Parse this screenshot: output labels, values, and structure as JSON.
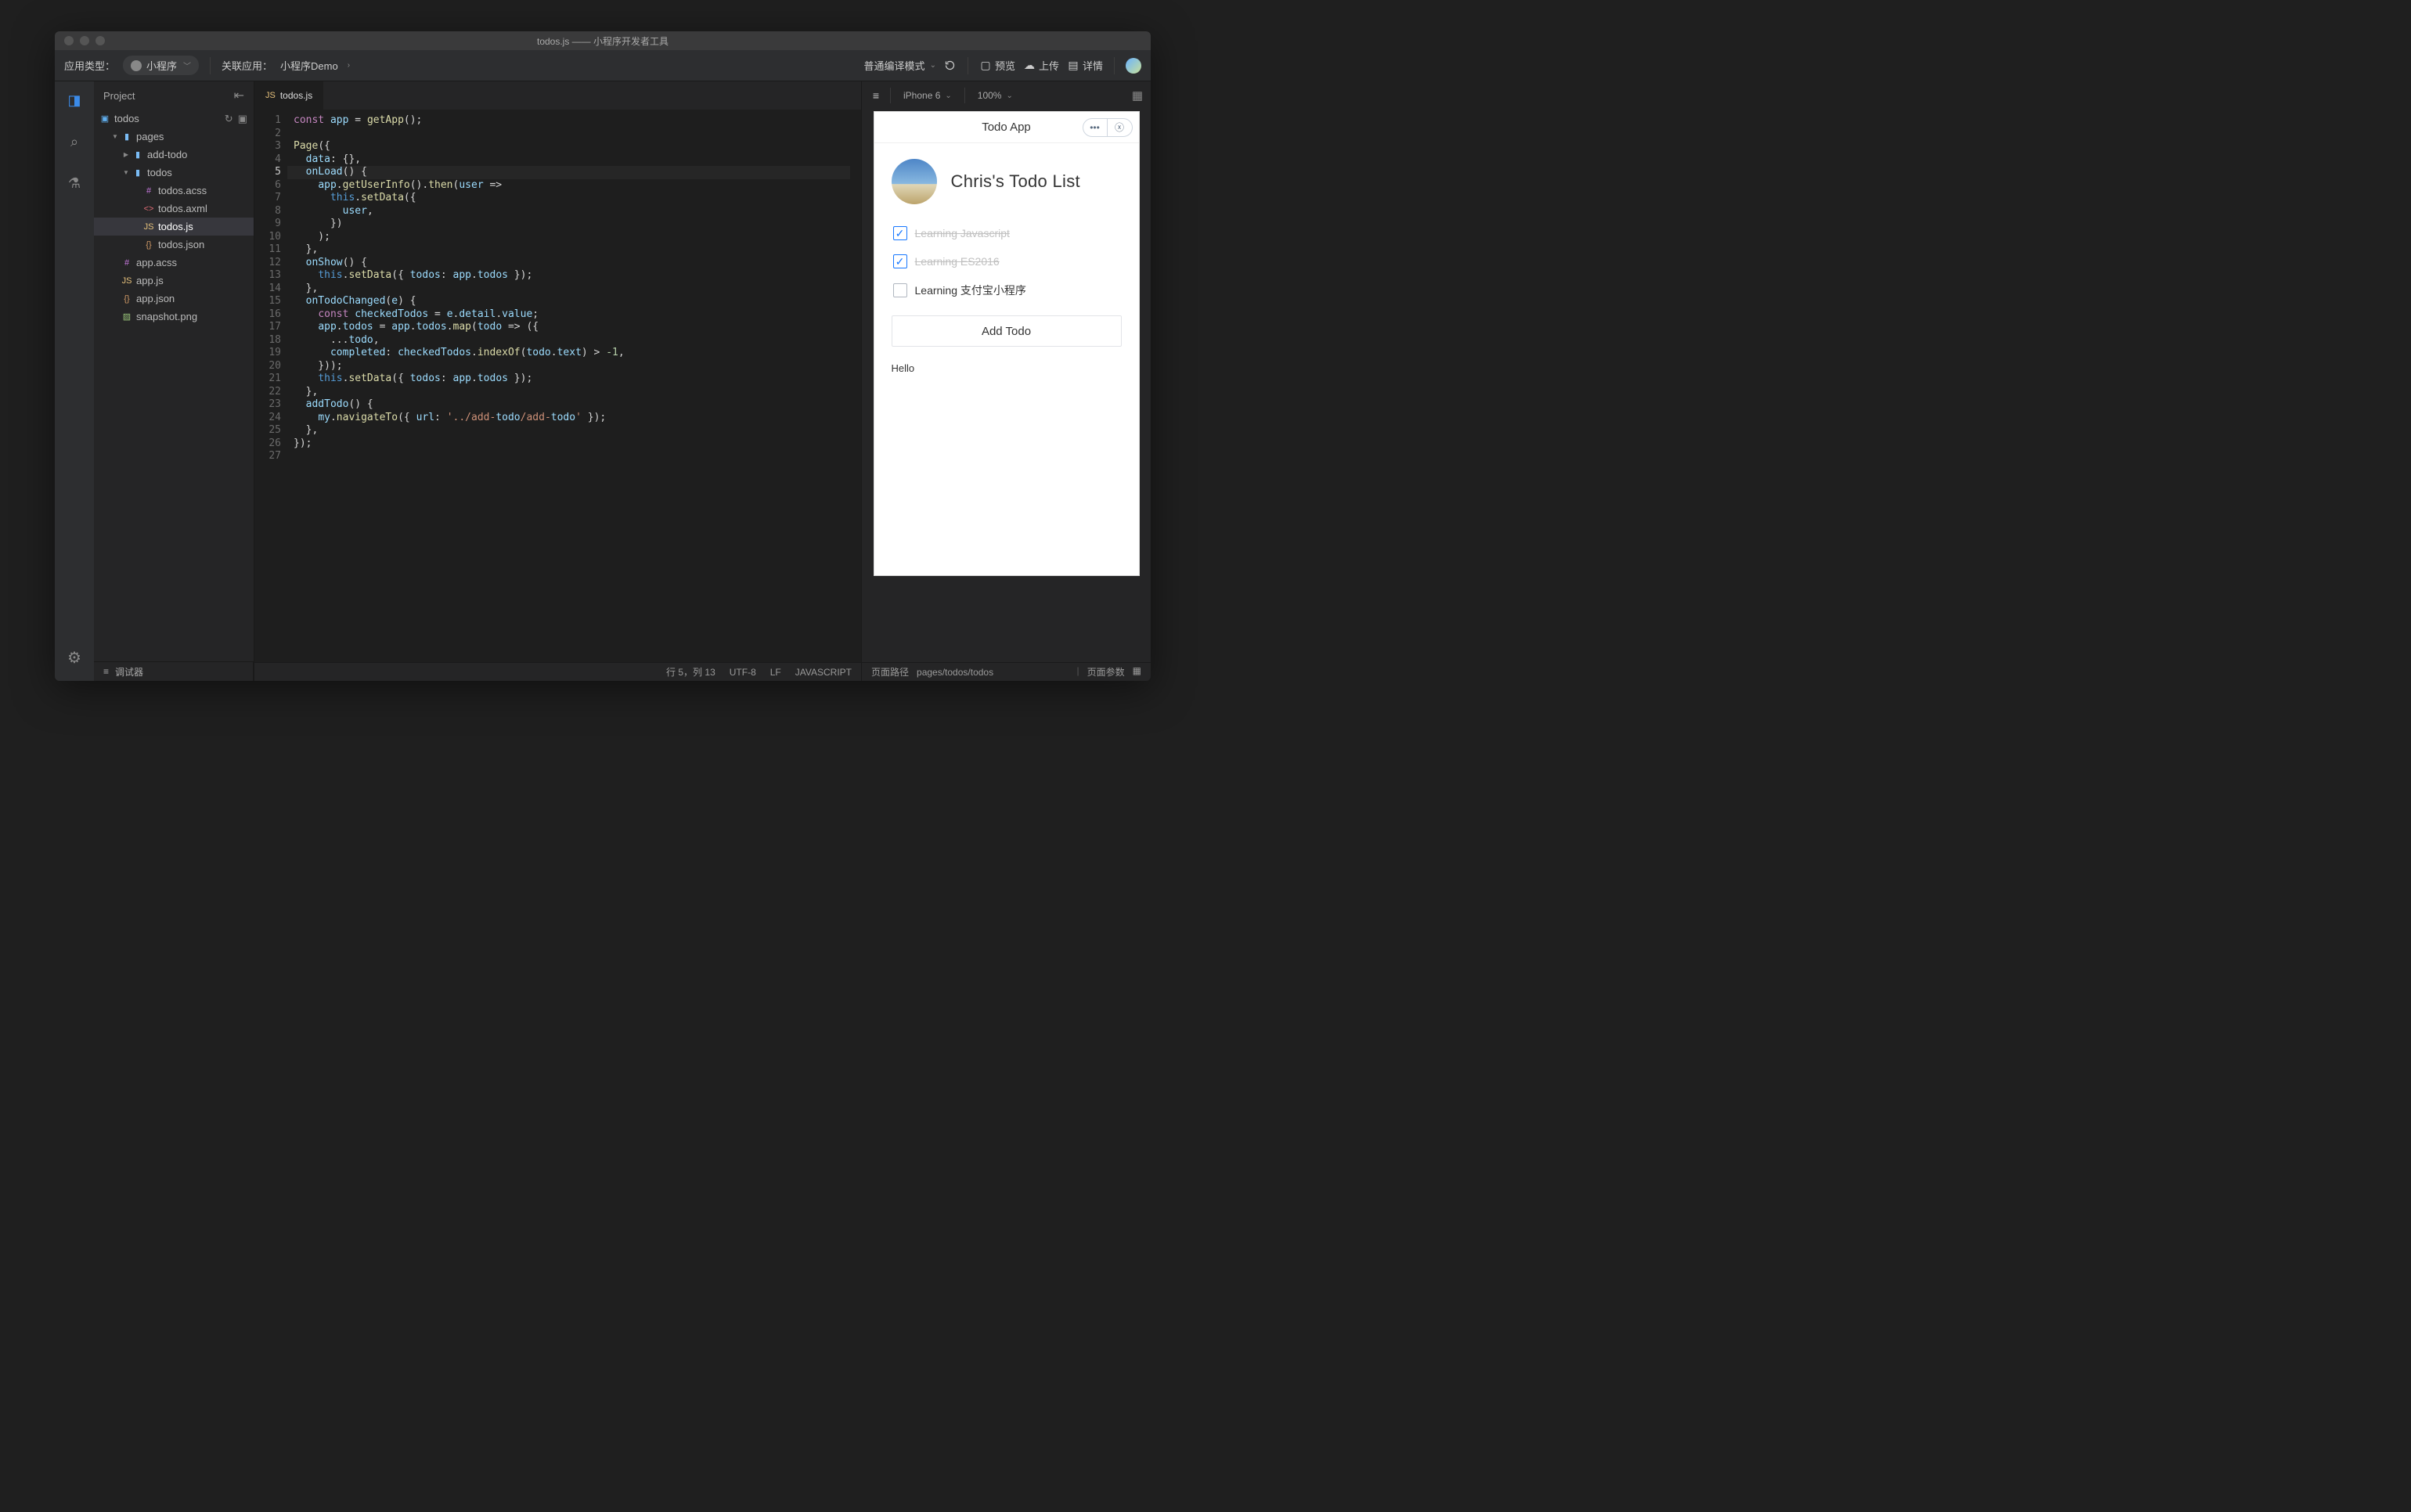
{
  "window": {
    "title": "todos.js —— 小程序开发者工具"
  },
  "menubar": {
    "app_type_label": "应用类型：",
    "app_type_value": "小程序",
    "assoc_label": "关联应用：",
    "assoc_value": "小程序Demo",
    "compile_mode": "普通编译模式",
    "preview": "预览",
    "upload": "上传",
    "details": "详情"
  },
  "explorer": {
    "header": "Project",
    "root": "todos",
    "items": [
      {
        "type": "folder",
        "name": "pages",
        "expanded": true,
        "depth": 1
      },
      {
        "type": "folder",
        "name": "add-todo",
        "expanded": false,
        "depth": 2
      },
      {
        "type": "folder",
        "name": "todos",
        "expanded": true,
        "depth": 2
      },
      {
        "type": "file",
        "name": "todos.acss",
        "icon": "hash",
        "depth": 3
      },
      {
        "type": "file",
        "name": "todos.axml",
        "icon": "xml",
        "depth": 3
      },
      {
        "type": "file",
        "name": "todos.js",
        "icon": "js",
        "depth": 3,
        "selected": true
      },
      {
        "type": "file",
        "name": "todos.json",
        "icon": "json",
        "depth": 3
      },
      {
        "type": "file",
        "name": "app.acss",
        "icon": "hash",
        "depth": 1
      },
      {
        "type": "file",
        "name": "app.js",
        "icon": "js",
        "depth": 1
      },
      {
        "type": "file",
        "name": "app.json",
        "icon": "json",
        "depth": 1
      },
      {
        "type": "file",
        "name": "snapshot.png",
        "icon": "img",
        "depth": 1
      }
    ]
  },
  "editor": {
    "tab_label": "todos.js",
    "lines": [
      "const app = getApp();",
      "",
      "Page({",
      "  data: {},",
      "  onLoad() {",
      "    app.getUserInfo().then(user =>",
      "      this.setData({",
      "        user,",
      "      })",
      "    );",
      "  },",
      "  onShow() {",
      "    this.setData({ todos: app.todos });",
      "  },",
      "  onTodoChanged(e) {",
      "    const checkedTodos = e.detail.value;",
      "    app.todos = app.todos.map(todo => ({",
      "      ...todo,",
      "      completed: checkedTodos.indexOf(todo.text) > -1,",
      "    }));",
      "    this.setData({ todos: app.todos });",
      "  },",
      "  addTodo() {",
      "    my.navigateTo({ url: '../add-todo/add-todo' });",
      "  },",
      "});",
      ""
    ],
    "current_line": 5,
    "total_lines": 27
  },
  "statusbar": {
    "debugger": "调试器",
    "line_col": "行 5，列 13",
    "encoding": "UTF-8",
    "eol": "LF",
    "language": "JAVASCRIPT"
  },
  "simulator": {
    "device": "iPhone 6",
    "zoom": "100%",
    "app_title": "Todo App",
    "user_name": "Chris's Todo List",
    "todos": [
      {
        "label": "Learning Javascript",
        "done": true
      },
      {
        "label": "Learning ES2016",
        "done": true
      },
      {
        "label": "Learning 支付宝小程序",
        "done": false
      }
    ],
    "add_button": "Add Todo",
    "hello": "Hello",
    "page_path_label": "页面路径",
    "page_path": "pages/todos/todos",
    "page_params_label": "页面参数"
  }
}
